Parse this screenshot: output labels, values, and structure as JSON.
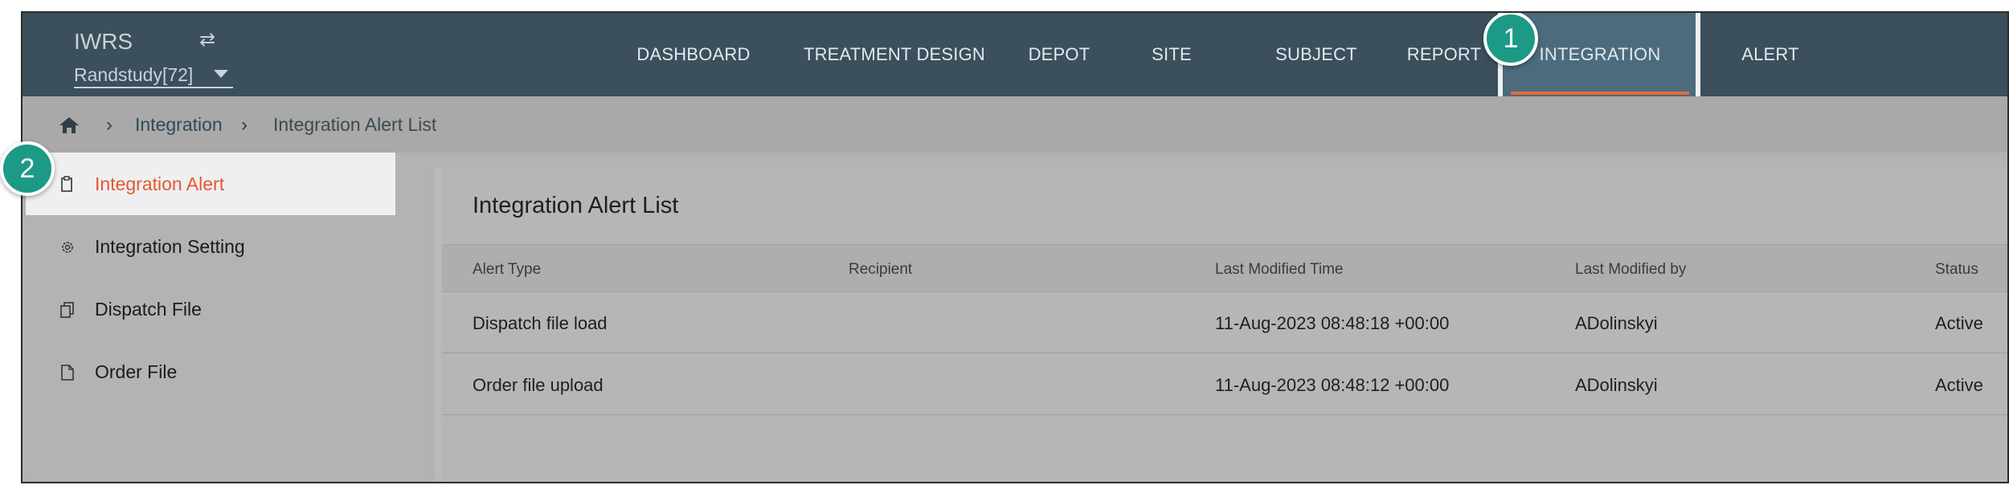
{
  "header": {
    "brand": "IWRS",
    "study": "Randstudy[72]",
    "nav": [
      {
        "label": "DASHBOARD"
      },
      {
        "label": "TREATMENT DESIGN"
      },
      {
        "label": "DEPOT"
      },
      {
        "label": "SITE"
      },
      {
        "label": "SUBJECT"
      },
      {
        "label": "REPORT"
      },
      {
        "label": "INTEGRATION",
        "active": true
      },
      {
        "label": "ALERT"
      }
    ]
  },
  "breadcrumb": {
    "items": [
      "Integration",
      "Integration Alert List"
    ]
  },
  "sidebar": {
    "items": [
      {
        "label": "Integration Alert",
        "icon": "clipboard-icon",
        "active": true
      },
      {
        "label": "Integration Setting",
        "icon": "gear-icon"
      },
      {
        "label": "Dispatch File",
        "icon": "copy-file-icon"
      },
      {
        "label": "Order File",
        "icon": "file-icon"
      }
    ]
  },
  "main": {
    "title": "Integration Alert List",
    "columns": [
      "Alert Type",
      "Recipient",
      "Last Modified Time",
      "Last Modified by",
      "Status"
    ],
    "rows": [
      {
        "alert_type": "Dispatch file load",
        "recipient": "",
        "time": "11-Aug-2023 08:48:18 +00:00",
        "by": "ADolinskyi",
        "status": "Active"
      },
      {
        "alert_type": "Order file upload",
        "recipient": "",
        "time": "11-Aug-2023 08:48:12 +00:00",
        "by": "ADolinskyi",
        "status": "Active"
      }
    ]
  },
  "badges": [
    "1",
    "2"
  ],
  "colors": {
    "header_bg": "#3b505c",
    "accent": "#e4582e",
    "badge": "#1c9a85"
  }
}
